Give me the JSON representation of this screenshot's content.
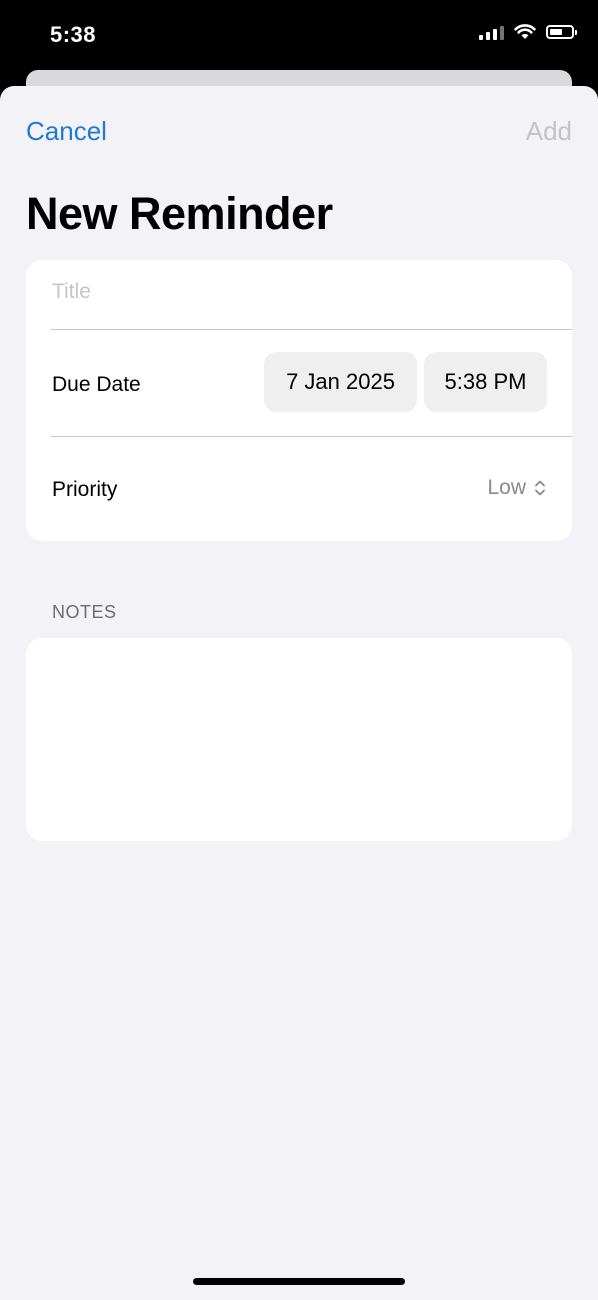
{
  "status_bar": {
    "time": "5:38",
    "icons": [
      "signal-icon",
      "wifi-icon",
      "battery-icon"
    ]
  },
  "nav": {
    "cancel_label": "Cancel",
    "add_label": "Add"
  },
  "page": {
    "title": "New Reminder"
  },
  "form": {
    "title_placeholder": "Title",
    "title_value": "",
    "due_date_label": "Due Date",
    "date_value": "7 Jan 2025",
    "time_value": "5:38 PM",
    "priority_label": "Priority",
    "priority_value": "Low",
    "priority_icon": "chevron-up-down-icon"
  },
  "notes": {
    "header": "NOTES",
    "value": ""
  },
  "colors": {
    "accent": "#1f7ad6",
    "disabled": "#c2c2c7",
    "sheet_background": "#f2f2f7",
    "card_background": "#ffffff",
    "pill_background": "#efeff0"
  }
}
